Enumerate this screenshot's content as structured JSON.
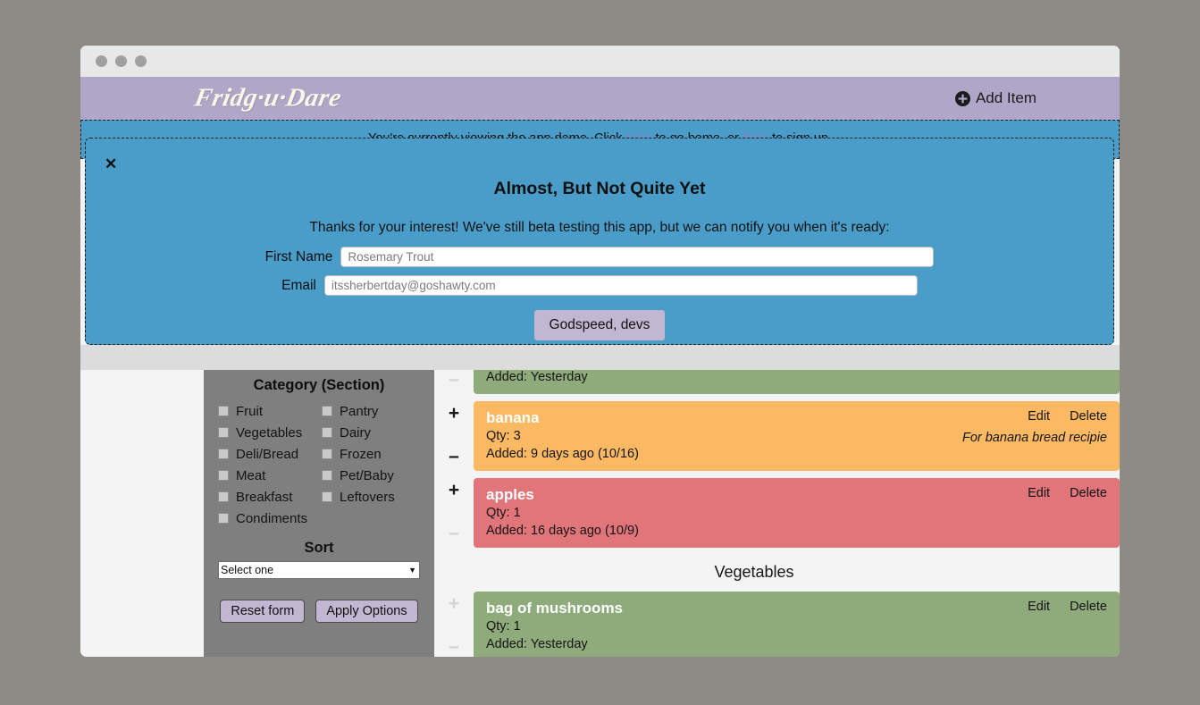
{
  "app": {
    "logo": "Fridg·u·Dare",
    "add_item_label": "Add Item"
  },
  "demo_banner": {
    "text_before": "You're currently viewing the app demo. Click ",
    "link1": "here",
    "text_middle": " to go home, or ",
    "link2": "here",
    "text_after": " to sign up."
  },
  "modal": {
    "close_label": "✕",
    "title": "Almost, But Not Quite Yet",
    "subtitle": "Thanks for your interest! We've still beta testing this app, but we can notify you when it's ready:",
    "first_name_label": "First Name",
    "first_name_value": "Rosemary Trout",
    "email_label": "Email",
    "email_value": "itssherbertday@goshawty.com",
    "submit_label": "Godspeed, devs"
  },
  "sidebar": {
    "category_title": "Category (Section)",
    "categories": [
      {
        "label": "Fruit",
        "checked": false
      },
      {
        "label": "Pantry",
        "checked": false
      },
      {
        "label": "Vegetables",
        "checked": false
      },
      {
        "label": "Dairy",
        "checked": false
      },
      {
        "label": "Deli/Bread",
        "checked": false
      },
      {
        "label": "Frozen",
        "checked": false
      },
      {
        "label": "Meat",
        "checked": false
      },
      {
        "label": "Pet/Baby",
        "checked": false
      },
      {
        "label": "Breakfast",
        "checked": false
      },
      {
        "label": "Leftovers",
        "checked": false
      },
      {
        "label": "Condiments",
        "checked": false
      }
    ],
    "sort_title": "Sort",
    "sort_selected": "Select one",
    "sort_caret": "▼",
    "reset_label": "Reset form",
    "apply_label": "Apply Options"
  },
  "items": {
    "clipped_item": {
      "added": "Added: Yesterday",
      "color": "green",
      "minus": "–",
      "minus_dim": true
    },
    "banana": {
      "name": "banana",
      "qty": "Qty: 3",
      "added": "Added: 9 days ago (10/16)",
      "note": "For banana bread recipie",
      "edit": "Edit",
      "delete": "Delete",
      "plus": "+",
      "minus": "–",
      "plus_dim": false,
      "minus_dim": false,
      "color": "orange"
    },
    "apples": {
      "name": "apples",
      "qty": "Qty: 1",
      "added": "Added: 16 days ago (10/9)",
      "note": "",
      "edit": "Edit",
      "delete": "Delete",
      "plus": "+",
      "minus": "–",
      "plus_dim": false,
      "minus_dim": true,
      "color": "red"
    },
    "vegetables_heading": "Vegetables",
    "mushrooms": {
      "name": "bag of mushrooms",
      "qty": "Qty: 1",
      "added": "Added: Yesterday",
      "note": "",
      "edit": "Edit",
      "delete": "Delete",
      "plus": "+",
      "minus": "–",
      "plus_dim": true,
      "minus_dim": true,
      "color": "green"
    }
  },
  "colors": {
    "header": "#b0a6c8",
    "modal": "#4a9dc8",
    "sidebar": "#7f7f7f",
    "green": "#8fab7c",
    "orange": "#fbb963",
    "red": "#e0757a",
    "accent_button": "#c2b6d2"
  }
}
